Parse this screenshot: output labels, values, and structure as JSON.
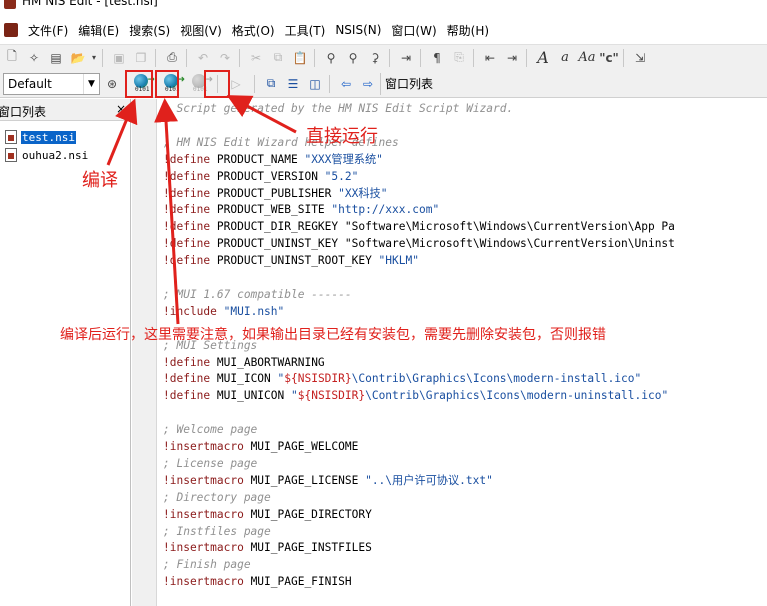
{
  "window": {
    "title": "HM NIS Edit - [test.nsi]"
  },
  "menu": [
    "文件(F)",
    "编辑(E)",
    "搜索(S)",
    "视图(V)",
    "格式(O)",
    "工具(T)",
    "NSIS(N)",
    "窗口(W)",
    "帮助(H)"
  ],
  "toolbar": {
    "style_combo_value": "Default",
    "window_list_label": "窗口列表"
  },
  "panel": {
    "title": "窗口列表",
    "close": "×",
    "files": [
      "test.nsi",
      "ouhua2.nsi"
    ]
  },
  "code": [
    "; Script generated by the HM NIS Edit Script Wizard.",
    "",
    "; HM NIS Edit Wizard helper defines",
    "!define PRODUCT_NAME \"XXX管理系统\"",
    "!define PRODUCT_VERSION \"5.2\"",
    "!define PRODUCT_PUBLISHER \"XX科技\"",
    "!define PRODUCT_WEB_SITE \"http://xxx.com\"",
    "!define PRODUCT_DIR_REGKEY \"Software\\Microsoft\\Windows\\CurrentVersion\\App Pa",
    "!define PRODUCT_UNINST_KEY \"Software\\Microsoft\\Windows\\CurrentVersion\\Uninst",
    "!define PRODUCT_UNINST_ROOT_KEY \"HKLM\"",
    "",
    "; MUI 1.67 compatible ------",
    "!include \"MUI.nsh\"",
    "",
    "; MUI Settings",
    "!define MUI_ABORTWARNING",
    "!define MUI_ICON \"${NSISDIR}\\Contrib\\Graphics\\Icons\\modern-install.ico\"",
    "!define MUI_UNICON \"${NSISDIR}\\Contrib\\Graphics\\Icons\\modern-uninstall.ico\"",
    "",
    "; Welcome page",
    "!insertmacro MUI_PAGE_WELCOME",
    "; License page",
    "!insertmacro MUI_PAGE_LICENSE \"..\\用户许可协议.txt\"",
    "; Directory page",
    "!insertmacro MUI_PAGE_DIRECTORY",
    "; Instfiles page",
    "!insertmacro MUI_PAGE_INSTFILES",
    "; Finish page",
    "!insertmacro MUI_PAGE_FINISH"
  ],
  "annotations": {
    "compile": "编译",
    "run": "直接运行",
    "compile_run": "编译后运行，这里需要注意，如果输出目录已经有安装包，需要先删除安装包，否则报错"
  },
  "colors": {
    "annotation": "#e0211c",
    "keyword": "#8b1a1a",
    "comment": "#909090",
    "string": "#1a4fa0",
    "selection": "#0a64c8"
  }
}
